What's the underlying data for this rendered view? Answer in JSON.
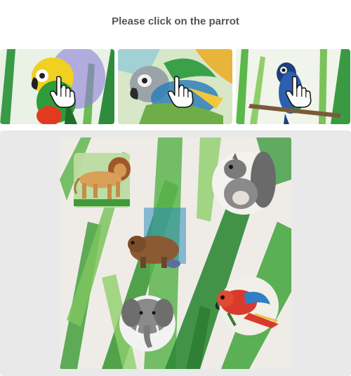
{
  "instruction": "Please click on the parrot",
  "examples": [
    {
      "subject": "parrot",
      "icon": "hand-pointer-icon"
    },
    {
      "subject": "parrot",
      "icon": "hand-pointer-icon"
    },
    {
      "subject": "parrot",
      "icon": "hand-pointer-icon"
    }
  ],
  "puzzle": {
    "animals": [
      "lion",
      "squirrel",
      "bear",
      "elephant",
      "parrot"
    ]
  },
  "colors": {
    "background": "#ffffff",
    "panel": "#e9e9e9",
    "text": "#555555",
    "leaf_green": "#3f9a3a",
    "parrot_red": "#d93a2c"
  }
}
